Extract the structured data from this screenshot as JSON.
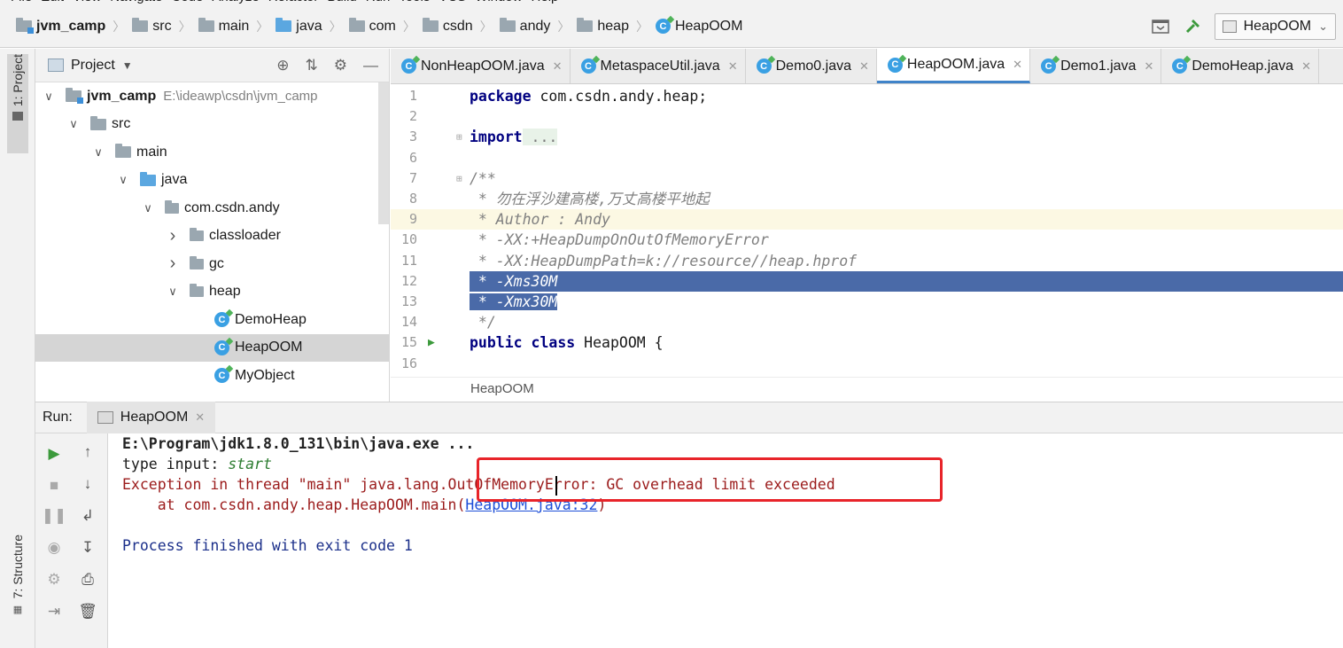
{
  "menu": [
    "File",
    "Edit",
    "View",
    "Navigate",
    "Code",
    "Analyze",
    "Refactor",
    "Build",
    "Run",
    "Tools",
    "VCS",
    "Window",
    "Help"
  ],
  "breadcrumb": [
    "jvm_camp",
    "src",
    "main",
    "java",
    "com",
    "csdn",
    "andy",
    "heap",
    "HeapOOM"
  ],
  "run_config": "HeapOOM",
  "left_stripe": {
    "project_tab": "1: Project",
    "structure_tab": "7: Structure"
  },
  "project_panel": {
    "title": "Project",
    "tree": [
      {
        "label": "jvm_camp",
        "hint": "E:\\ideawp\\csdn\\jvm_camp",
        "arrow": "down",
        "type": "project"
      },
      {
        "label": "src",
        "arrow": "down",
        "type": "folder"
      },
      {
        "label": "main",
        "arrow": "down",
        "type": "folder"
      },
      {
        "label": "java",
        "arrow": "down",
        "type": "folder-blue"
      },
      {
        "label": "com.csdn.andy",
        "arrow": "down",
        "type": "package"
      },
      {
        "label": "classloader",
        "arrow": "right",
        "type": "package"
      },
      {
        "label": "gc",
        "arrow": "right",
        "type": "package"
      },
      {
        "label": "heap",
        "arrow": "down",
        "type": "package"
      },
      {
        "label": "DemoHeap",
        "type": "class"
      },
      {
        "label": "HeapOOM",
        "type": "class",
        "selected": true
      },
      {
        "label": "MyObject",
        "type": "class"
      }
    ]
  },
  "tabs": [
    {
      "label": "NonHeapOOM.java",
      "active": false
    },
    {
      "label": "MetaspaceUtil.java",
      "active": false
    },
    {
      "label": "Demo0.java",
      "active": false
    },
    {
      "label": "HeapOOM.java",
      "active": true
    },
    {
      "label": "Demo1.java",
      "active": false
    },
    {
      "label": "DemoHeap.java",
      "active": false
    }
  ],
  "editor": {
    "lines": [
      {
        "n": "1",
        "kw": "package",
        "text": " com.csdn.andy.heap;"
      },
      {
        "n": "2",
        "text": ""
      },
      {
        "n": "3",
        "kw": "import",
        "fold": " ..."
      },
      {
        "n": "6",
        "text": ""
      },
      {
        "n": "7",
        "comment": "/**"
      },
      {
        "n": "8",
        "comment": " * 勿在浮沙建高楼,万丈高楼平地起"
      },
      {
        "n": "9",
        "comment": " * Author : Andy",
        "caret": true
      },
      {
        "n": "10",
        "comment": " * -XX:+HeapDumpOnOutOfMemoryError"
      },
      {
        "n": "11",
        "comment": " * -XX:HeapDumpPath=k://resource//heap.hprof"
      },
      {
        "n": "12",
        "selected": " * -Xms30M",
        "full": true
      },
      {
        "n": "13",
        "selected": " * -Xmx30M"
      },
      {
        "n": "14",
        "comment": " */"
      },
      {
        "n": "15",
        "kw": "public class",
        "text": " HeapOOM {",
        "run": true
      },
      {
        "n": "16",
        "text": ""
      }
    ],
    "footer": "HeapOOM"
  },
  "run": {
    "label": "Run:",
    "tab": "HeapOOM",
    "console": {
      "line1": "E:\\Program\\jdk1.8.0_131\\bin\\java.exe ...",
      "line2_prefix": "type input: ",
      "line2_value": "start",
      "line3": "Exception in thread \"main\" java.lang.OutOfMemoryError: GC overhead limit exceeded",
      "line4_prefix": "    at com.csdn.andy.heap.HeapOOM.main(",
      "line4_link": "HeapOOM.java:32",
      "line4_suffix": ")",
      "line5": "Process finished with exit code 1"
    }
  },
  "colors": {
    "accent_tab": "#4083c9",
    "selection": "#4a6aa8",
    "error_text": "#9b1b1b",
    "annotation_box": "#e8242a"
  }
}
